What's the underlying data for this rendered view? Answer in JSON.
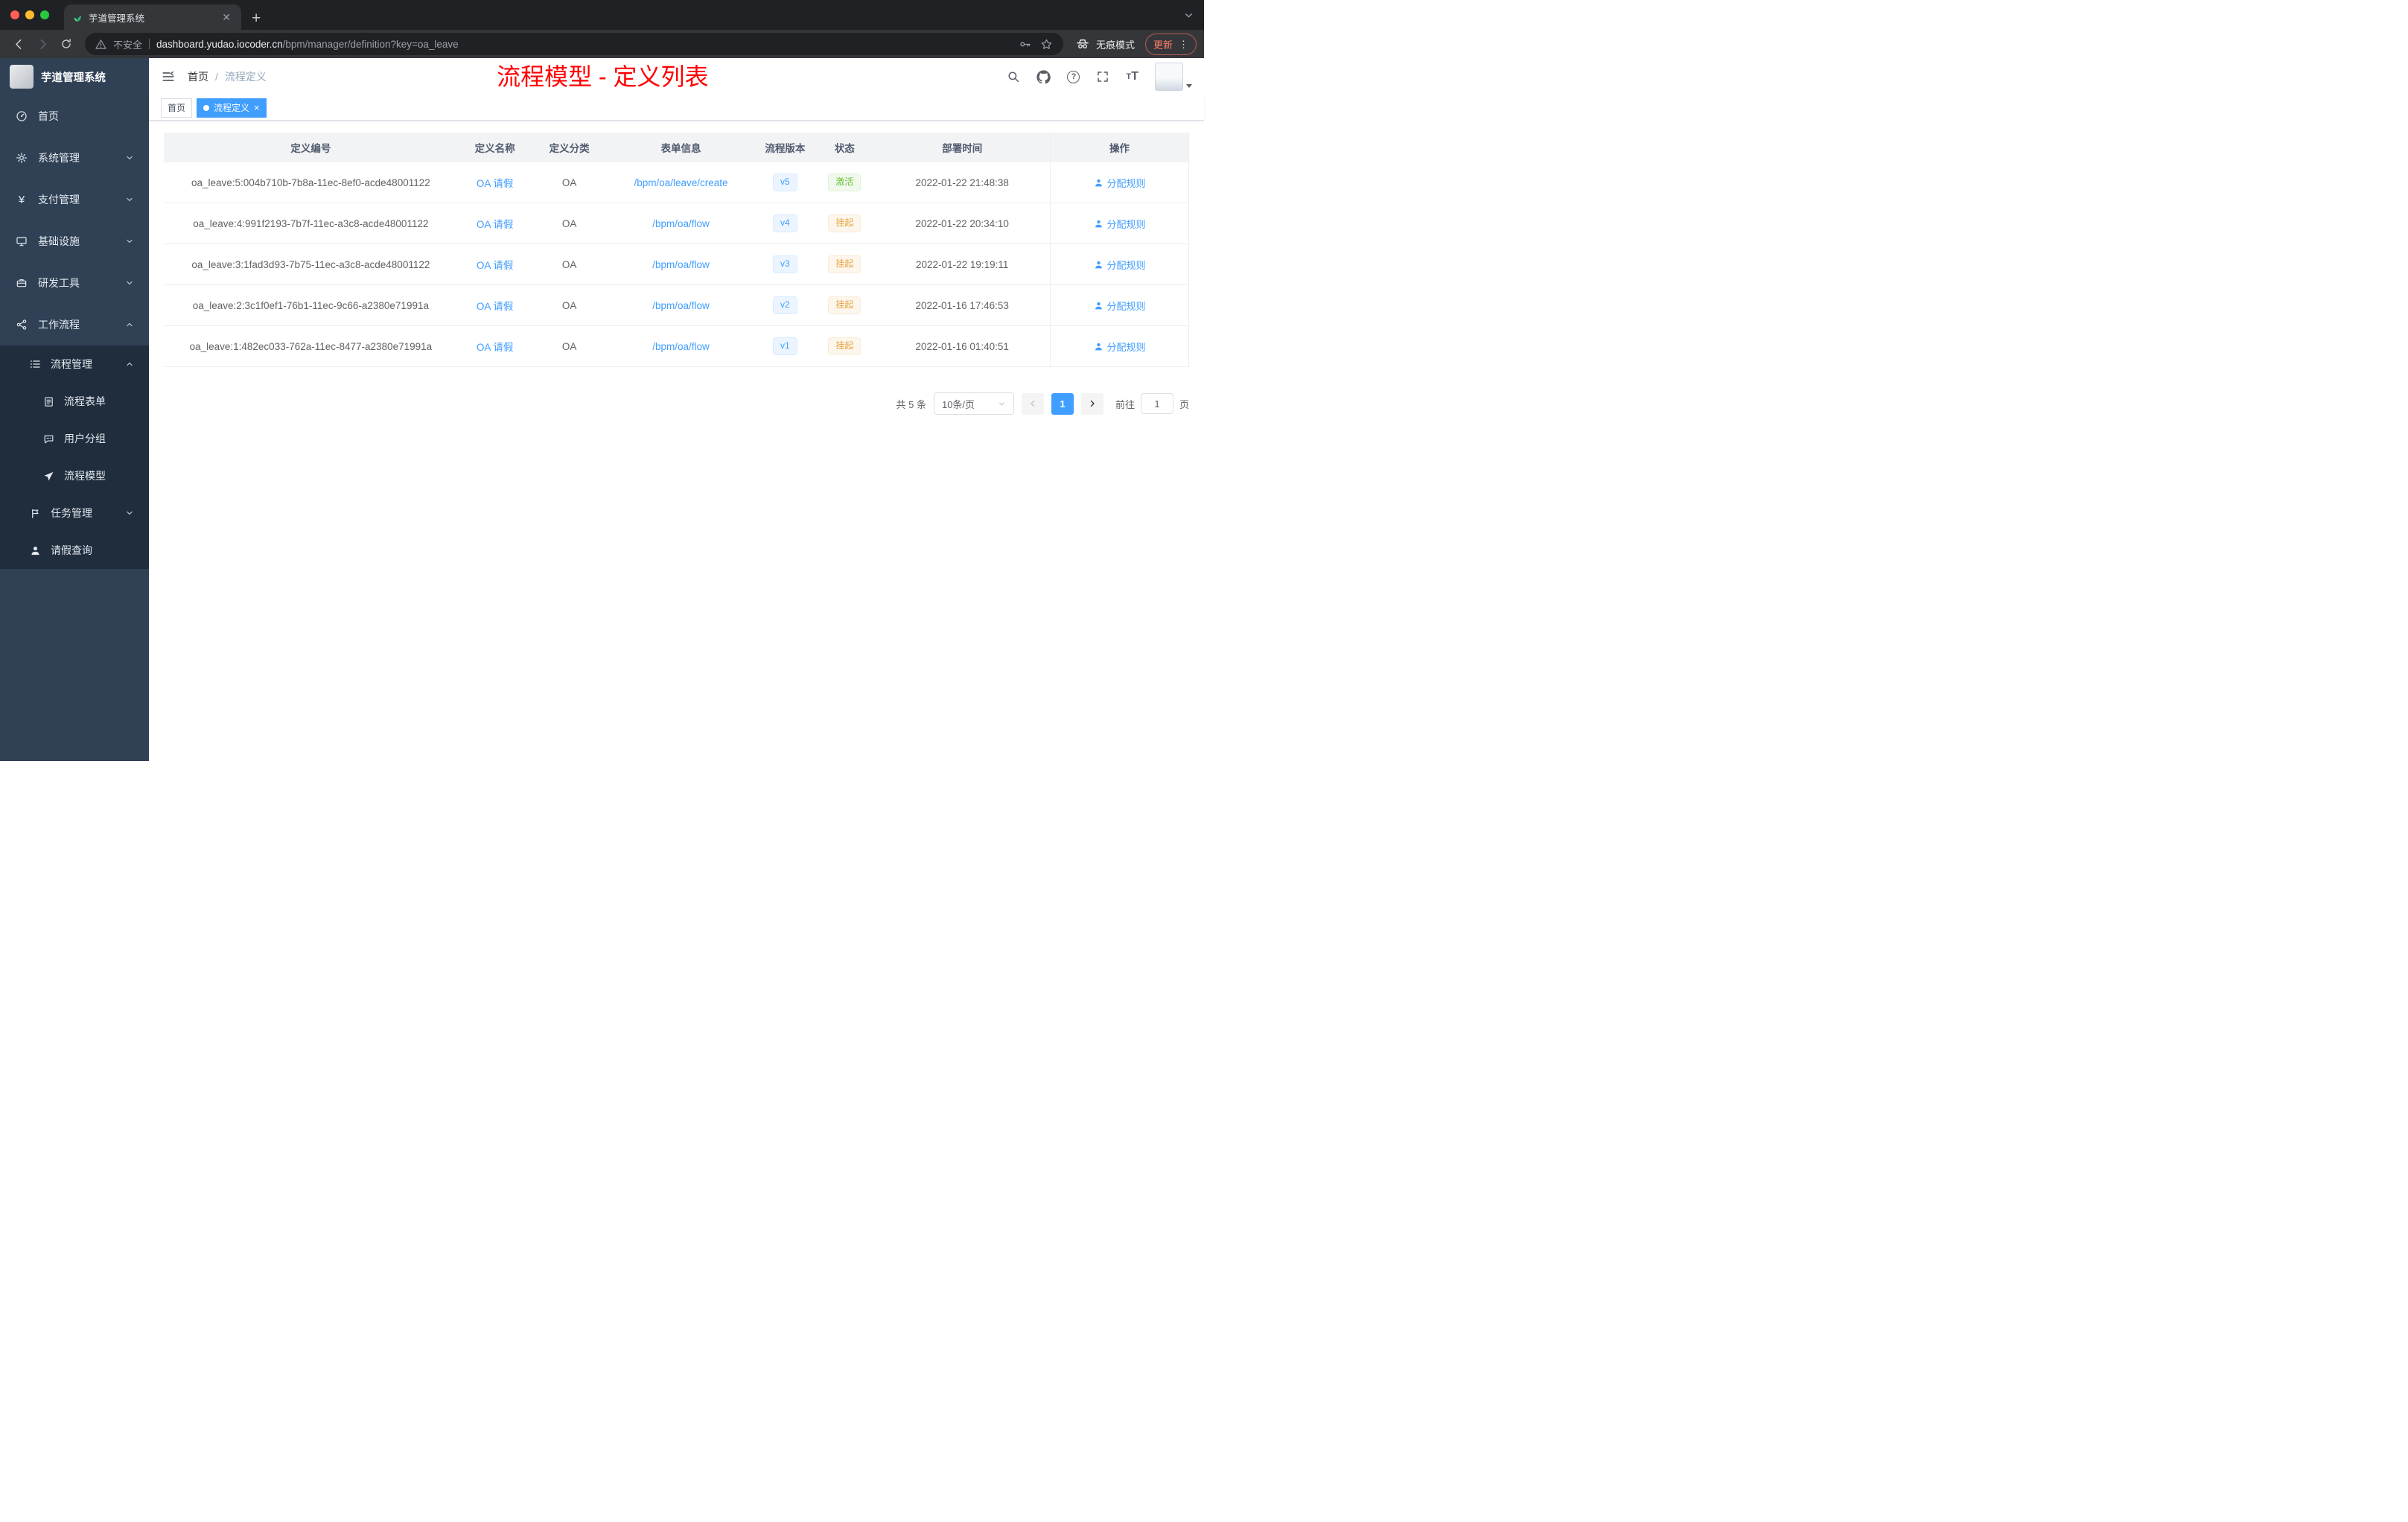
{
  "browser": {
    "tab_title": "芋道管理系统",
    "security_label": "不安全",
    "url_host": "dashboard.yudao.iocoder.cn",
    "url_rest": "/bpm/manager/definition?key=oa_leave",
    "incognito_label": "无痕模式",
    "update_label": "更新"
  },
  "sidebar": {
    "logo_title": "芋道管理系统",
    "menu": [
      {
        "label": "首页"
      },
      {
        "label": "系统管理"
      },
      {
        "label": "支付管理"
      },
      {
        "label": "基础设施"
      },
      {
        "label": "研发工具"
      },
      {
        "label": "工作流程"
      },
      {
        "label": "流程管理"
      },
      {
        "label": "流程表单"
      },
      {
        "label": "用户分组"
      },
      {
        "label": "流程模型"
      },
      {
        "label": "任务管理"
      },
      {
        "label": "请假查询"
      }
    ]
  },
  "header": {
    "breadcrumb_home": "首页",
    "breadcrumb_current": "流程定义",
    "annotation": "流程模型 - 定义列表"
  },
  "tags": {
    "home": "首页",
    "active": "流程定义"
  },
  "table": {
    "columns": [
      "定义编号",
      "定义名称",
      "定义分类",
      "表单信息",
      "流程版本",
      "状态",
      "部署时间",
      "操作"
    ],
    "action_label": "分配规则",
    "rows": [
      {
        "id": "oa_leave:5:004b710b-7b8a-11ec-8ef0-acde48001122",
        "name": "OA 请假",
        "category": "OA",
        "form": "/bpm/oa/leave/create",
        "version": "v5",
        "status": "激活",
        "time": "2022-01-22 21:48:38"
      },
      {
        "id": "oa_leave:4:991f2193-7b7f-11ec-a3c8-acde48001122",
        "name": "OA 请假",
        "category": "OA",
        "form": "/bpm/oa/flow",
        "version": "v4",
        "status": "挂起",
        "time": "2022-01-22 20:34:10"
      },
      {
        "id": "oa_leave:3:1fad3d93-7b75-11ec-a3c8-acde48001122",
        "name": "OA 请假",
        "category": "OA",
        "form": "/bpm/oa/flow",
        "version": "v3",
        "status": "挂起",
        "time": "2022-01-22 19:19:11"
      },
      {
        "id": "oa_leave:2:3c1f0ef1-76b1-11ec-9c66-a2380e71991a",
        "name": "OA 请假",
        "category": "OA",
        "form": "/bpm/oa/flow",
        "version": "v2",
        "status": "挂起",
        "time": "2022-01-16 17:46:53"
      },
      {
        "id": "oa_leave:1:482ec033-762a-11ec-8477-a2380e71991a",
        "name": "OA 请假",
        "category": "OA",
        "form": "/bpm/oa/flow",
        "version": "v1",
        "status": "挂起",
        "time": "2022-01-16 01:40:51"
      }
    ]
  },
  "pagination": {
    "total": "共 5 条",
    "page_size": "10条/页",
    "page": "1",
    "goto_label": "前往",
    "goto_value": "1",
    "goto_unit": "页"
  },
  "colors": {
    "accent_blue": "#409eff",
    "success_green": "#67c23a",
    "warning_orange": "#e6a23c",
    "annotation_red": "#ff0000",
    "sidebar_bg": "#304156",
    "submenu_bg": "#1f2d3d"
  }
}
